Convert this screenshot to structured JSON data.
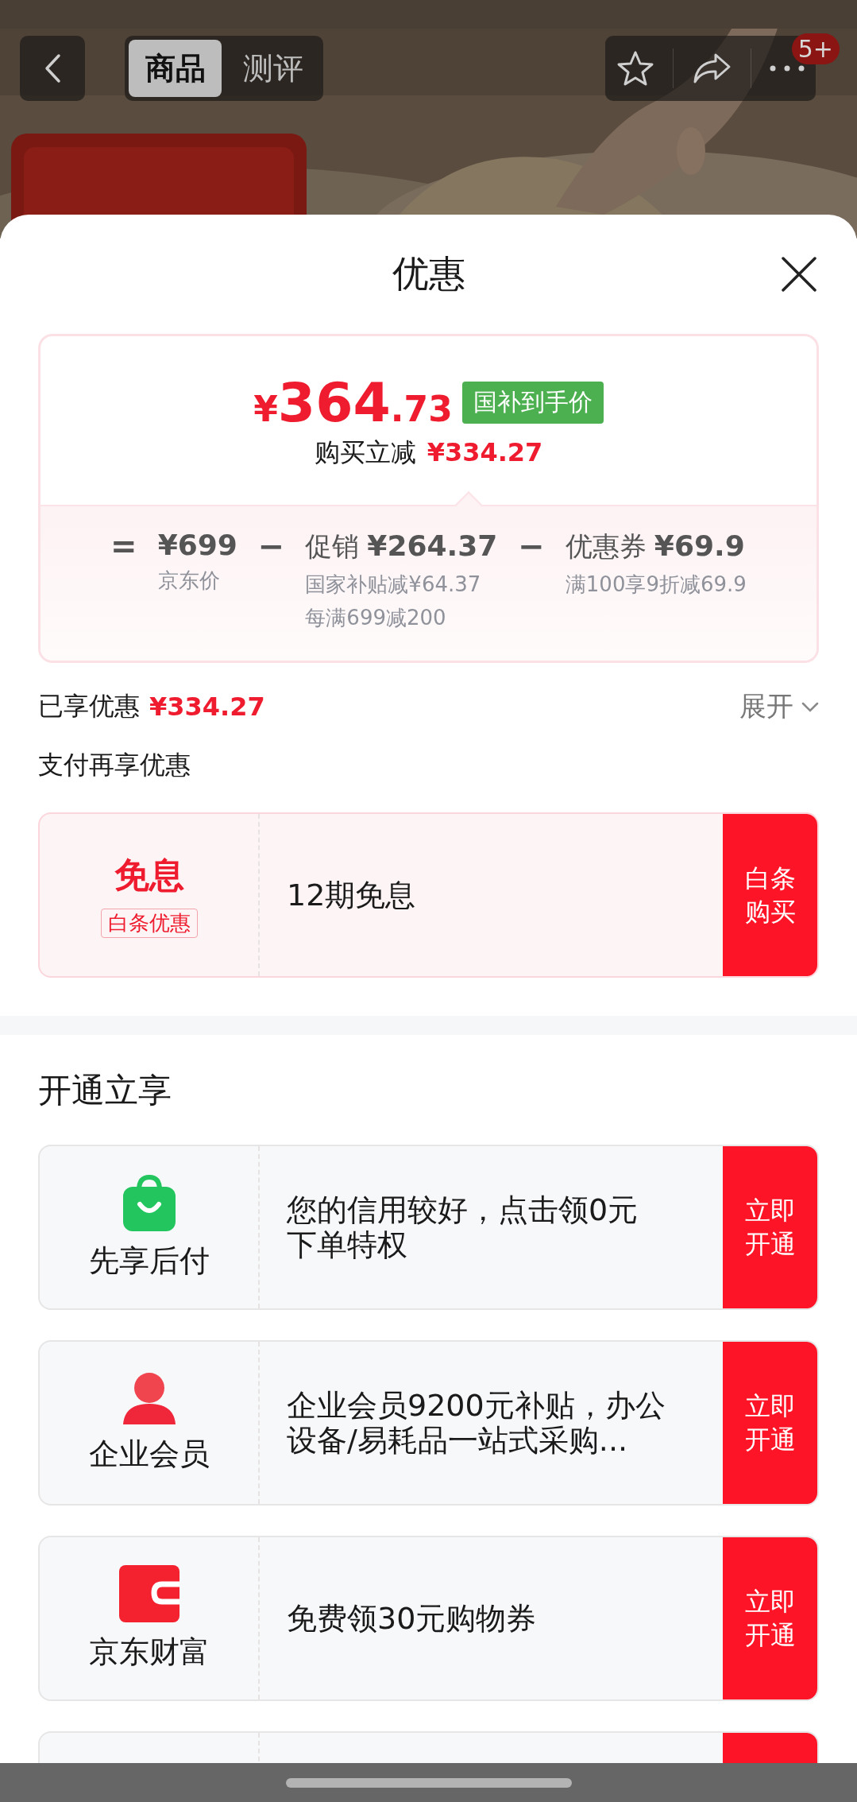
{
  "nav": {
    "tabs": [
      {
        "label": "商品",
        "selected": true
      },
      {
        "label": "测评",
        "selected": false
      }
    ],
    "badge": "5+"
  },
  "sheet": {
    "title": "优惠"
  },
  "price_card": {
    "currency": "¥",
    "price_integer": "364",
    "price_decimal": ".73",
    "tag": "国补到手价",
    "saving_label": "购买立减",
    "saving_amount": "¥334.27",
    "breakdown": [
      {
        "operator": "=",
        "amount": "¥699",
        "notes": [
          "京东价"
        ]
      },
      {
        "operator": "−",
        "label": "促销",
        "amount": "¥264.37",
        "notes": [
          "国家补贴减¥64.37",
          "每满699减200"
        ]
      },
      {
        "operator": "−",
        "label": "优惠券",
        "amount": "¥69.9",
        "notes": [
          "满100享9折减69.9"
        ]
      }
    ]
  },
  "enjoyed": {
    "label": "已享优惠",
    "amount": "¥334.27",
    "expand": "展开"
  },
  "pay_section": {
    "title": "支付再享优惠",
    "offers": [
      {
        "kind": "interest",
        "title": "免息",
        "tag": "白条优惠",
        "text": "12期免息",
        "action": "白条购买"
      }
    ]
  },
  "open_section": {
    "title": "开通立享",
    "offers": [
      {
        "kind": "bag",
        "name": "先享后付",
        "text": "您的信用较好，点击领0元下单特权",
        "action": "立即开通"
      },
      {
        "kind": "person",
        "name": "企业会员",
        "text": "企业会员9200元补贴，办公设备/易耗品一站式采购...",
        "action": "立即开通"
      },
      {
        "kind": "wallet",
        "name": "京东财富",
        "text": "免费领30元购物券",
        "action": "立即开通"
      },
      {
        "kind": "partial"
      }
    ]
  }
}
